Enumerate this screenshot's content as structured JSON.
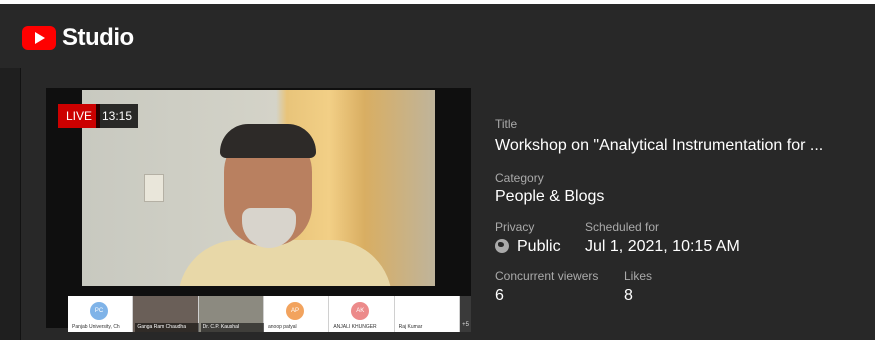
{
  "app": {
    "logo_text": "Studio"
  },
  "stream": {
    "live_badge": "LIVE",
    "elapsed": "13:15",
    "participants": [
      {
        "initials": "PC",
        "name": "Panjab University, Ch",
        "avatar_color": "#7fb3e8"
      },
      {
        "initials": "",
        "name": "Ganga Ram Chaudha",
        "avatar_color": ""
      },
      {
        "initials": "",
        "name": "Dr. C.P. Kaushal",
        "avatar_color": ""
      },
      {
        "initials": "AP",
        "name": "anoop patyal",
        "avatar_color": "#f2a35e"
      },
      {
        "initials": "AK",
        "name": "ANJALI KHUNGER",
        "avatar_color": "#ec8a8a"
      },
      {
        "initials": "",
        "name": "Raj Kumar",
        "avatar_color": ""
      }
    ],
    "more_count": "+5"
  },
  "details": {
    "title_label": "Title",
    "title_value": "Workshop on \"Analytical Instrumentation for ...",
    "category_label": "Category",
    "category_value": "People & Blogs",
    "privacy_label": "Privacy",
    "privacy_value": "Public",
    "scheduled_label": "Scheduled for",
    "scheduled_value": "Jul 1, 2021, 10:15 AM",
    "viewers_label": "Concurrent viewers",
    "viewers_value": "6",
    "likes_label": "Likes",
    "likes_value": "8"
  },
  "colors": {
    "accent": "#ff0000",
    "live": "#cc0000",
    "background": "#1f1f1f",
    "panel": "#282828"
  }
}
